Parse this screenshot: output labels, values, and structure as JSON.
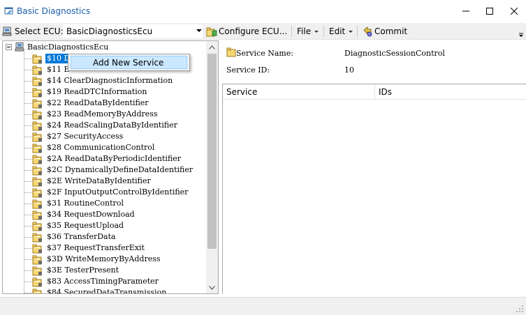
{
  "window": {
    "title": "Basic Diagnostics",
    "controls": {
      "minimize_icon": "minimize-icon",
      "maximize_icon": "maximize-icon",
      "close_icon": "close-icon"
    }
  },
  "toolbar": {
    "select_ecu_label": "Select ECU:",
    "ecu_value": "BasicDiagnosticsEcu",
    "configure_label": "Configure ECU...",
    "file_label": "File",
    "edit_label": "Edit",
    "commit_label": "Commit"
  },
  "tree": {
    "root_label": "BasicDiagnosticsEcu",
    "selected_label": "$10 D",
    "items": [
      "$10 D",
      "$11 E",
      "$14 ClearDiagnosticInformation",
      "$19 ReadDTCInformation",
      "$22 ReadDataByIdentifier",
      "$23 ReadMemoryByAddress",
      "$24 ReadScalingDataByIdentifier",
      "$27 SecurityAccess",
      "$28 CommunicationControl",
      "$2A ReadDataByPeriodicIdentifier",
      "$2C DynamicallyDefineDataIdentifier",
      "$2E WriteDataByIdentifier",
      "$2F InputOutputControlByIdentifier",
      "$31 RoutineControl",
      "$34 RequestDownload",
      "$35 RequestUpload",
      "$36 TransferData",
      "$37 RequestTransferExit",
      "$3D WriteMemoryByAddress",
      "$3E TesterPresent",
      "$83 AccessTimingParameter",
      "$84 SecuredDataTransmission"
    ]
  },
  "context_menu": {
    "item_label": "Add New Service"
  },
  "detail": {
    "service_name_label": "Service Name:",
    "service_name_value": "DiagnosticSessionControl",
    "service_id_label": "Service ID:",
    "service_id_value": "10",
    "columns": [
      "Service",
      "IDs"
    ]
  },
  "colors": {
    "title_text": "#1b5fa8",
    "selection": "#0078d7",
    "menu_highlight": "#cce8ff"
  }
}
